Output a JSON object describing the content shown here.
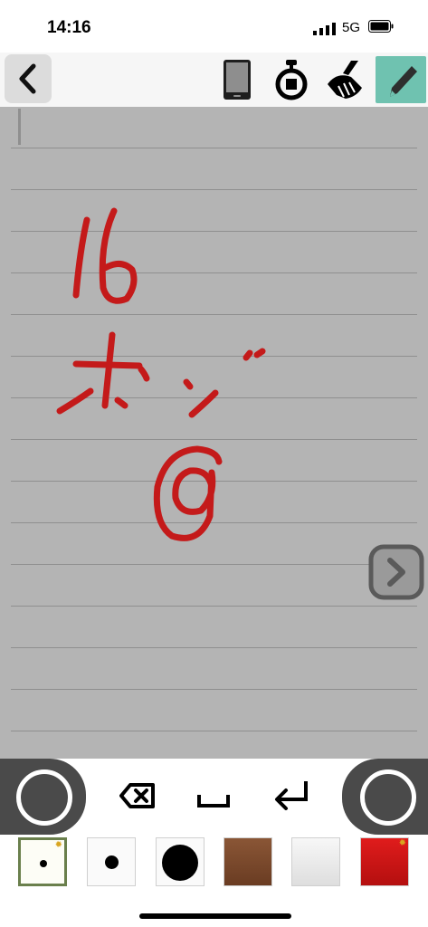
{
  "status": {
    "time": "14:16",
    "network": "5G"
  },
  "toolbar": {
    "back_icon": "chevron-left-icon",
    "icons": [
      "phone-icon",
      "stopwatch-icon",
      "broom-icon",
      "pencil-icon"
    ],
    "active_tool": "pencil-icon",
    "active_color": "#6fc2b0"
  },
  "canvas": {
    "background": "#b4b4b4",
    "ink_color": "#c41a1a",
    "handwriting": [
      "16",
      "ポジ",
      "@"
    ],
    "line_count": 15,
    "next_icon": "chevron-right-icon"
  },
  "keys": {
    "left_ring": "circle-button",
    "backspace_icon": "backspace-icon",
    "space_icon": "space-icon",
    "return_icon": "return-icon",
    "right_ring": "circle-button"
  },
  "palette": {
    "items": [
      {
        "type": "pen-size",
        "size": "small",
        "selected": true,
        "settings": true
      },
      {
        "type": "pen-size",
        "size": "medium",
        "selected": false,
        "settings": false
      },
      {
        "type": "pen-size",
        "size": "large",
        "selected": false,
        "settings": false
      },
      {
        "type": "color",
        "color": "#7b4a2f",
        "settings": false
      },
      {
        "type": "color",
        "color": "#ececec",
        "settings": false
      },
      {
        "type": "color",
        "color": "#d01616",
        "settings": true
      }
    ]
  }
}
